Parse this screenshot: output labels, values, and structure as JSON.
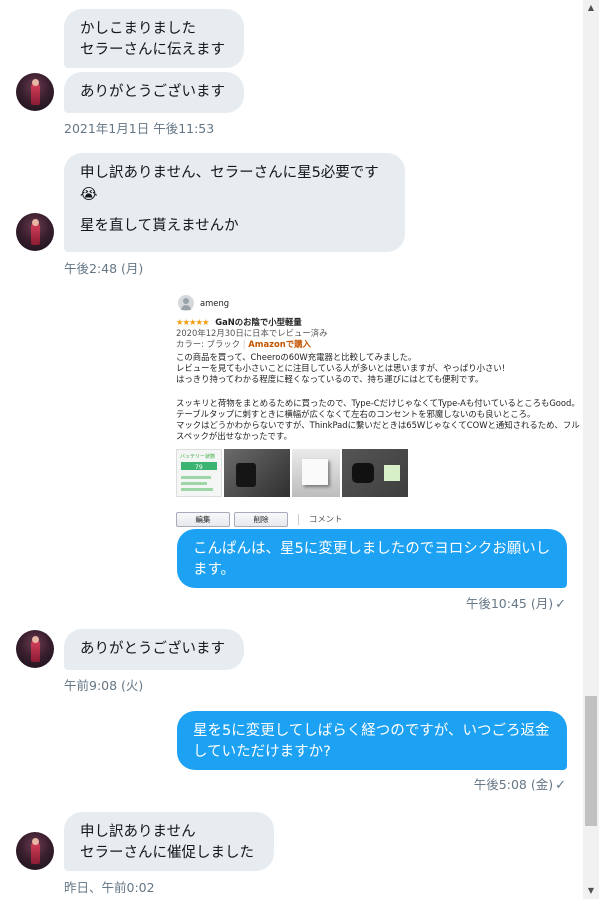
{
  "messages": {
    "m1": "かしこまりました\nセラーさんに伝えます",
    "m2": "ありがとうございます",
    "t1": "2021年1月1日 午後11:53",
    "m3_line1": "申し訳ありません、セラーさんに星5必要です",
    "m3_emoji": "😭",
    "m3_line3": "星を直して貰えませんか",
    "t2": "午後2:48 (月)",
    "m4": "こんぱんは、星5に変更しましたのでヨロシクお願いします。",
    "t3": "午後10:45 (月)",
    "m5": "ありがとうございます",
    "t4": "午前9:08 (火)",
    "m6": "星を5に変更してしばらく経つのですが、いつごろ返金していただけますか?",
    "t5": "午後5:08 (金)",
    "m7": "申し訳ありません\nセラーさんに催促しました",
    "t6": "昨日、午前0:02",
    "read_mark": "✓"
  },
  "review": {
    "username": "ameng",
    "stars": "★★★★★",
    "title": "GaNのお陰で小型軽量",
    "date": "2020年12月30日に日本でレビュー済み",
    "color_label": "カラー: ブラック",
    "verified": "Amazonで購入",
    "body1": "この商品を買って、Cheeroの60W充電器と比較してみました。",
    "body2": "レビューを見ても小さいことに注目している人が多いとは思いますが、やっぱり小さい!",
    "body3": "はっきり持ってわかる程度に軽くなっているので、持ち運びにはとても便利です。",
    "body4": "スッキリと荷物をまとめるために買ったので、Type-CだけじゃなくてType-Aも付いているところもGood。",
    "body5": "テーブルタップに刺すときに横幅が広くなくて左右のコンセントを邪魔しないのも良いところ。",
    "body6": "マックはどうかわからないですが、ThinkPadに繋いだときは65WじゃなくてCOWと通知されるため、フル",
    "body7": "スペックが出せなかったです。",
    "img1_label": "バッテリー状態",
    "img1_value": "79",
    "edit_btn": "編集",
    "delete_btn": "削除",
    "comment_link": "コメント"
  },
  "scrollbar": {
    "up_arrow": "▲",
    "down_arrow": "▼"
  },
  "colors": {
    "incoming_bubble": "#e6ecf0",
    "outgoing_bubble": "#1da1f2",
    "meta_text": "#657786",
    "star": "#f39c12"
  }
}
